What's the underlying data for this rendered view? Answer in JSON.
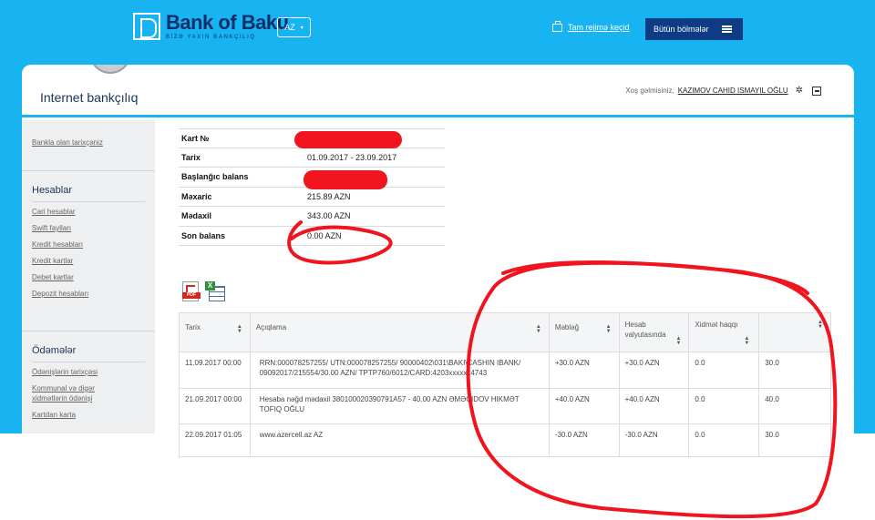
{
  "header": {
    "bank_name": "Bank of Baku",
    "tagline": "BİZƏ YAXIN BANKÇILIQ",
    "language": "AZ",
    "full_mode_link": "Tam rejimə keçid",
    "all_sections_button": "Bütün bölmələr"
  },
  "page": {
    "title": "Internet bankçılıq",
    "welcome_text": "Xoş gəlmisiniz,",
    "user_name": "KAZIMOV CAHID ISMAYIL OĞLU"
  },
  "sidebar": {
    "top_link": "Bankla olan tarixçəniz",
    "sections": [
      {
        "title": "Hesablar",
        "links": [
          "Cari hesablar",
          "Swift faylları",
          "Kredit hesabları",
          "Kredit kartlar",
          "Debet kartlar",
          "Depozit hesabları"
        ]
      },
      {
        "title": "Ödəmələr",
        "links": [
          "Ödənişlərin tarixçəsi",
          "Kommunal və digər xidmətlərin ödənişi",
          "Kartdan karta"
        ]
      }
    ]
  },
  "summary": {
    "rows": [
      {
        "label": "Kart №",
        "value": ""
      },
      {
        "label": "Tarix",
        "value": "01.09.2017 - 23.09.2017"
      },
      {
        "label": "Başlanğıc balans",
        "value": ""
      },
      {
        "label": "Məxaric",
        "value": "215.89 AZN"
      },
      {
        "label": "Mədaxil",
        "value": "343.00 AZN"
      },
      {
        "label": "Son balans",
        "value": "0.00 AZN"
      }
    ]
  },
  "export": {
    "pdf_label": "PDF",
    "excel_label": "X"
  },
  "transactions": {
    "columns": [
      "Tarix",
      "Açıqlama",
      "Məbləğ",
      "Hesab valyutasında",
      "Xidmət haqqı",
      ""
    ],
    "rows": [
      {
        "date": "11.09.2017 00:00",
        "description": "RRN:000078257255/ UTN:000078257255/ 90000402\\031\\BAKI\\CASHIN IBANK/ 09092017/215554/30.00 AZN/ TPTP760/6012/CARD:4203xxxxxx4743",
        "amount": "+30.0 AZN",
        "account_amount": "+30.0 AZN",
        "fee": "0.0",
        "balance": "30.0"
      },
      {
        "date": "21.09.2017 00:00",
        "description": "Hesaba nəğd mədaxil 380100020390791A57 - 40.00 AZN ƏMƏCIDOV HIKMƏT TOFIQ OĞLU",
        "amount": "+40.0 AZN",
        "account_amount": "+40.0 AZN",
        "fee": "0.0",
        "balance": "40.0"
      },
      {
        "date": "22.09.2017 01:05",
        "description": "www.azercell.az AZ",
        "amount": "-30.0 AZN",
        "account_amount": "-30.0 AZN",
        "fee": "0.0",
        "balance": "30.0"
      }
    ]
  },
  "colors": {
    "brand_blue": "#17b4f1",
    "navy": "#0d3b84",
    "positive": "#1a9a2e",
    "negative": "#e0303a",
    "annotation_red": "#f0141e"
  }
}
